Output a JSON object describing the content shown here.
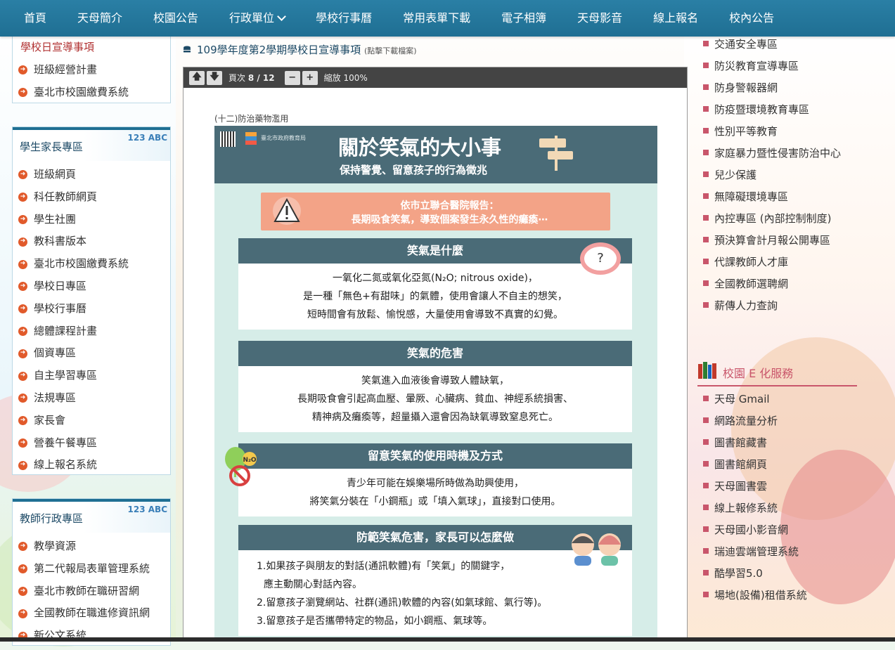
{
  "nav": {
    "items": [
      "首頁",
      "天母簡介",
      "校園公告",
      "行政單位",
      "學校行事曆",
      "常用表單下載",
      "電子相簿",
      "天母影音",
      "線上報名",
      "校內公告"
    ]
  },
  "left_top": {
    "items": [
      "學校日宣導事項",
      "班級經營計畫",
      "臺北市校園繳費系統"
    ]
  },
  "parent_zone": {
    "title": "學生家長專區",
    "deco": "123 ABC",
    "items": [
      "班級網頁",
      "科任教師網頁",
      "學生社團",
      "教科書版本",
      "臺北市校園繳費系統",
      "學校日專區",
      "學校行事曆",
      "總體課程計畫",
      "個資專區",
      "自主學習專區",
      "法規專區",
      "家長會",
      "營養午餐專區",
      "線上報名系統"
    ]
  },
  "teacher_zone": {
    "title": "教師行政專區",
    "deco": "123 ABC",
    "items": [
      "教學資源",
      "第二代報局表單管理系統",
      "臺北市教師在職研習網",
      "全國教師在職進修資訊網",
      "新公文系統"
    ]
  },
  "center": {
    "title": "109學年度第2學期學校日宣導事項",
    "note": "(點擊下載檔案)",
    "viewer": {
      "page_label": "頁次",
      "page": "8 / 12",
      "zoom_label": "縮放 100%"
    },
    "page_caption": "(十二)防治藥物濫用",
    "poster": {
      "title": "關於笑氣的大小事",
      "subtitle": "保持警覺、留意孩子的行為徵兆",
      "org": "臺北市政府教育局",
      "warning_line1": "依市立聯合醫院報告：",
      "warning_line2": "長期吸食笑氣，導致個案發生永久性的癱瘓⋯",
      "sections": [
        {
          "title": "笑氣是什麼",
          "lines": [
            "一氧化二氮或氧化亞氮(N₂O; nitrous oxide)，",
            "是一種「無色+有甜味」的氣體，使用會讓人不自主的想笑，",
            "短時間會有放鬆、愉悅感，大量使用會導致不真實的幻覺。"
          ]
        },
        {
          "title": "笑氣的危害",
          "lines": [
            "笑氣進入血液後會導致人體缺氧，",
            "長期吸食會引起高血壓、暈厥、心臟病、貧血、神經系統損害、",
            "精神病及癱瘓等，超量攝入還會因為缺氧導致窒息死亡。"
          ]
        },
        {
          "title": "留意笑氣的使用時機及方式",
          "lines": [
            "青少年可能在娛樂場所時做為助興使用，",
            "將笑氣分裝在「小鋼瓶」或「填入氣球」，直接對口使用。"
          ]
        },
        {
          "title": "防範笑氣危害，家長可以怎麼做",
          "lines": [
            "1.如果孩子與朋友的對話(通訊軟體)有「笑氣」的關鍵字，",
            "  應主動關心對話內容。",
            "2.留意孩子瀏覽網站、社群(通訊)軟體的內容(如氣球館、氣行等)。",
            "3.留意孩子是否攜帶特定的物品，如小鋼瓶、氣球等。"
          ]
        }
      ],
      "bubble_text": "?",
      "n2o_label": "N₂O"
    }
  },
  "right_top": {
    "items": [
      "交通安全專區",
      "防災教育宣導專區",
      "防身警報器網",
      "防疫暨環境教育專區",
      "性別平等教育",
      "家庭暴力暨性侵害防治中心",
      "兒少保護",
      "無障礙環境專區",
      "內控專區 (內部控制制度)",
      "預決算會計月報公開專區",
      "代課教師人才庫",
      "全國教師選聘網",
      "薪傳人力查詢"
    ]
  },
  "e_service": {
    "title": "校園 E 化服務",
    "items": [
      "天母 Gmail",
      "網路流量分析",
      "圖書館藏書",
      "圖書館網頁",
      "天母圖書雲",
      "線上報修系統",
      "天母國小影音網",
      "瑞迪雲端管理系統",
      "酷學習5.0",
      "場地(設備)租借系統"
    ]
  },
  "colors": {
    "nav": "#1f6f93",
    "accent": "#e15a2b",
    "right_accent": "#c9566b",
    "poster_dark": "#4a6b77",
    "poster_bg": "#d6ede8",
    "warning": "#f3a387"
  },
  "icons": [
    "arrow-up-icon",
    "arrow-down-icon",
    "minus-icon",
    "plus-icon",
    "database-icon",
    "bullet-arrow-icon",
    "square-bullet-icon",
    "books-icon",
    "qr-code-icon",
    "warning-icon",
    "question-bubble-icon",
    "no-n2o-icon",
    "faces-icon",
    "signpost-icon"
  ]
}
